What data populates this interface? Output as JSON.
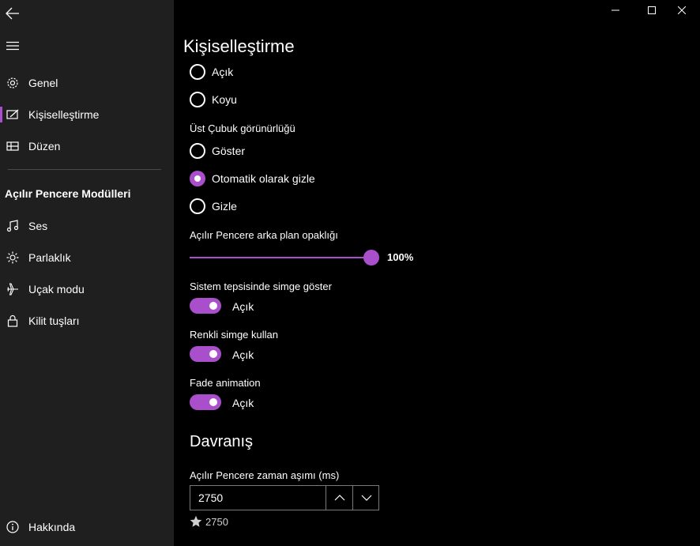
{
  "sidebar": {
    "items": [
      {
        "label": "Genel",
        "icon": "gear-icon"
      },
      {
        "label": "Kişiselleştirme",
        "icon": "personalize-icon"
      },
      {
        "label": "Düzen",
        "icon": "layout-icon"
      }
    ],
    "section_title": "Açılır Pencere Modülleri",
    "modules": [
      {
        "label": "Ses",
        "icon": "music-note-icon"
      },
      {
        "label": "Parlaklık",
        "icon": "brightness-icon"
      },
      {
        "label": "Uçak modu",
        "icon": "airplane-icon"
      },
      {
        "label": "Kilit tuşları",
        "icon": "lock-icon"
      }
    ],
    "about": {
      "label": "Hakkında",
      "icon": "info-icon"
    }
  },
  "page": {
    "title": "Kişiselleştirme",
    "theme_options": [
      "Açık",
      "Koyu"
    ],
    "topbar": {
      "label": "Üst Çubuk görünürlüğü",
      "options": [
        "Göster",
        "Otomatik olarak gizle",
        "Gizle"
      ],
      "selected": "Otomatik olarak gizle"
    },
    "opacity": {
      "label": "Açılır Pencere arka plan opaklığı",
      "value_text": "100%",
      "value": 100
    },
    "tray_icon": {
      "label": "Sistem tepsisinde simge göster",
      "state": "Açık"
    },
    "colored_icon": {
      "label": "Renkli simge kullan",
      "state": "Açık"
    },
    "fade": {
      "label": "Fade animation",
      "state": "Açık"
    },
    "behavior": {
      "heading": "Davranış",
      "timeout_label": "Açılır Pencere zaman aşımı (ms)",
      "timeout_value": "2750",
      "timeout_default": "2750"
    }
  },
  "colors": {
    "accent": "#a94fcb",
    "sidebar_bg": "#1f1f1f",
    "content_bg": "#000000"
  }
}
